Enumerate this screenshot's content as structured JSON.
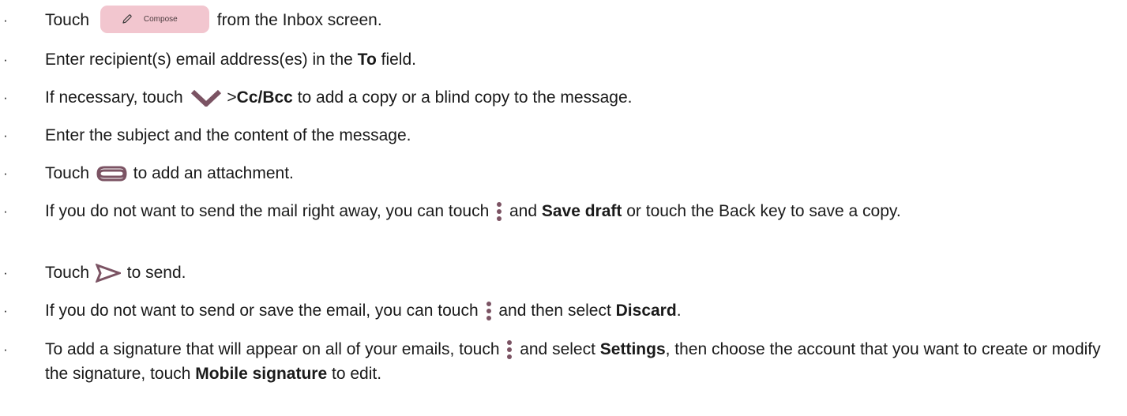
{
  "colors": {
    "icon_purple": "#7b5363",
    "compose_bg": "#f2c6cf"
  },
  "items": [
    {
      "bullet": "·",
      "parts": [
        "Touch",
        "Compose",
        "from the Inbox screen."
      ],
      "icons": [
        "pencil-icon"
      ]
    },
    {
      "bullet": "·",
      "parts": [
        "Enter recipient(s) email address(es) in the ",
        "To",
        " field."
      ]
    },
    {
      "bullet": "·",
      "parts": [
        "If necessary, touch",
        ">",
        "Cc/Bcc",
        " to add a copy or a blind copy to the message."
      ],
      "icons": [
        "chevron-down-icon"
      ]
    },
    {
      "bullet": "·",
      "parts": [
        "Enter the subject and the content of the message."
      ]
    },
    {
      "bullet": "·",
      "parts": [
        "Touch",
        "to add an attachment."
      ],
      "icons": [
        "paperclip-icon"
      ]
    },
    {
      "bullet": "·",
      "parts": [
        "If you do not want to send the mail right away, you can touch",
        "and ",
        "Save draft",
        " or touch the Back key to save a copy."
      ],
      "icons": [
        "more-vert-icon"
      ]
    },
    {
      "bullet": "·",
      "parts": [
        "Touch",
        "to send."
      ],
      "icons": [
        "send-icon"
      ]
    },
    {
      "bullet": "·",
      "parts": [
        "If you do not want to send or save the email, you can touch",
        "and then select ",
        "Discard",
        "."
      ],
      "icons": [
        "more-vert-icon"
      ]
    },
    {
      "bullet": "·",
      "parts": [
        "To add a signature that will appear on all of your emails, touch",
        "and select ",
        "Settings",
        ", then choose the account that you want to create or modify the signature, touch ",
        "Mobile signature",
        " to edit."
      ],
      "icons": [
        "more-vert-icon"
      ]
    }
  ]
}
